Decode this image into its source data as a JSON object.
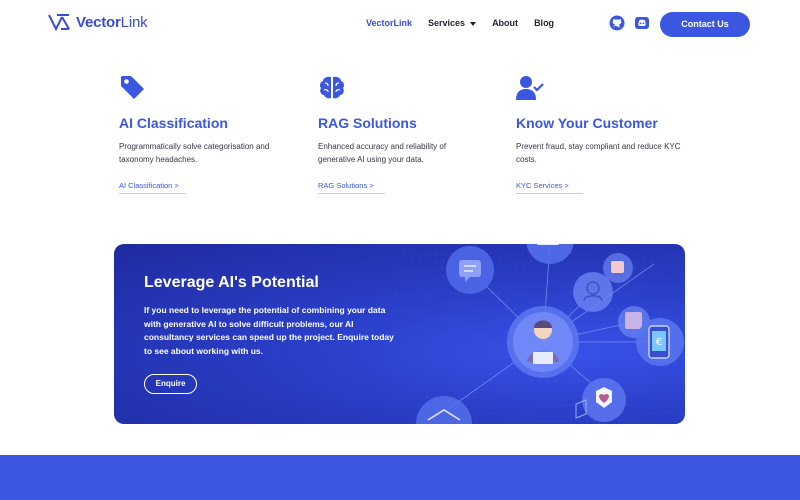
{
  "nav": {
    "logo_bold": "Vector",
    "logo_thin": "Link",
    "links": [
      "VectorLink",
      "Services",
      "About",
      "Blog"
    ],
    "contact_label": "Contact Us"
  },
  "services": [
    {
      "icon": "tag-icon",
      "title": "AI Classification",
      "description": "Programmatically solve categorisation and taxonomy headaches.",
      "link": "AI Classification >"
    },
    {
      "icon": "brain-icon",
      "title": "RAG Solutions",
      "description": "Enhanced accuracy and reliability of generative AI using your data.",
      "link": "RAG Solutions >"
    },
    {
      "icon": "user-check-icon",
      "title": "Know Your Customer",
      "description": "Prevent fraud, stay compliant and reduce KYC costs.",
      "link": "KYC Services >"
    }
  ],
  "banner": {
    "title": "Leverage AI's Potential",
    "text_before": "If you need to leverage the potential of combining your data with generative AI to solve difficult problems, our ",
    "text_strong": "AI consultancy services",
    "text_after": " can speed up the project. Enquire today to see about working with us.",
    "button": "Enquire"
  },
  "colors": {
    "brand": "#3b57e2",
    "banner_dark": "#1f2a9e",
    "text": "#1f2433"
  }
}
